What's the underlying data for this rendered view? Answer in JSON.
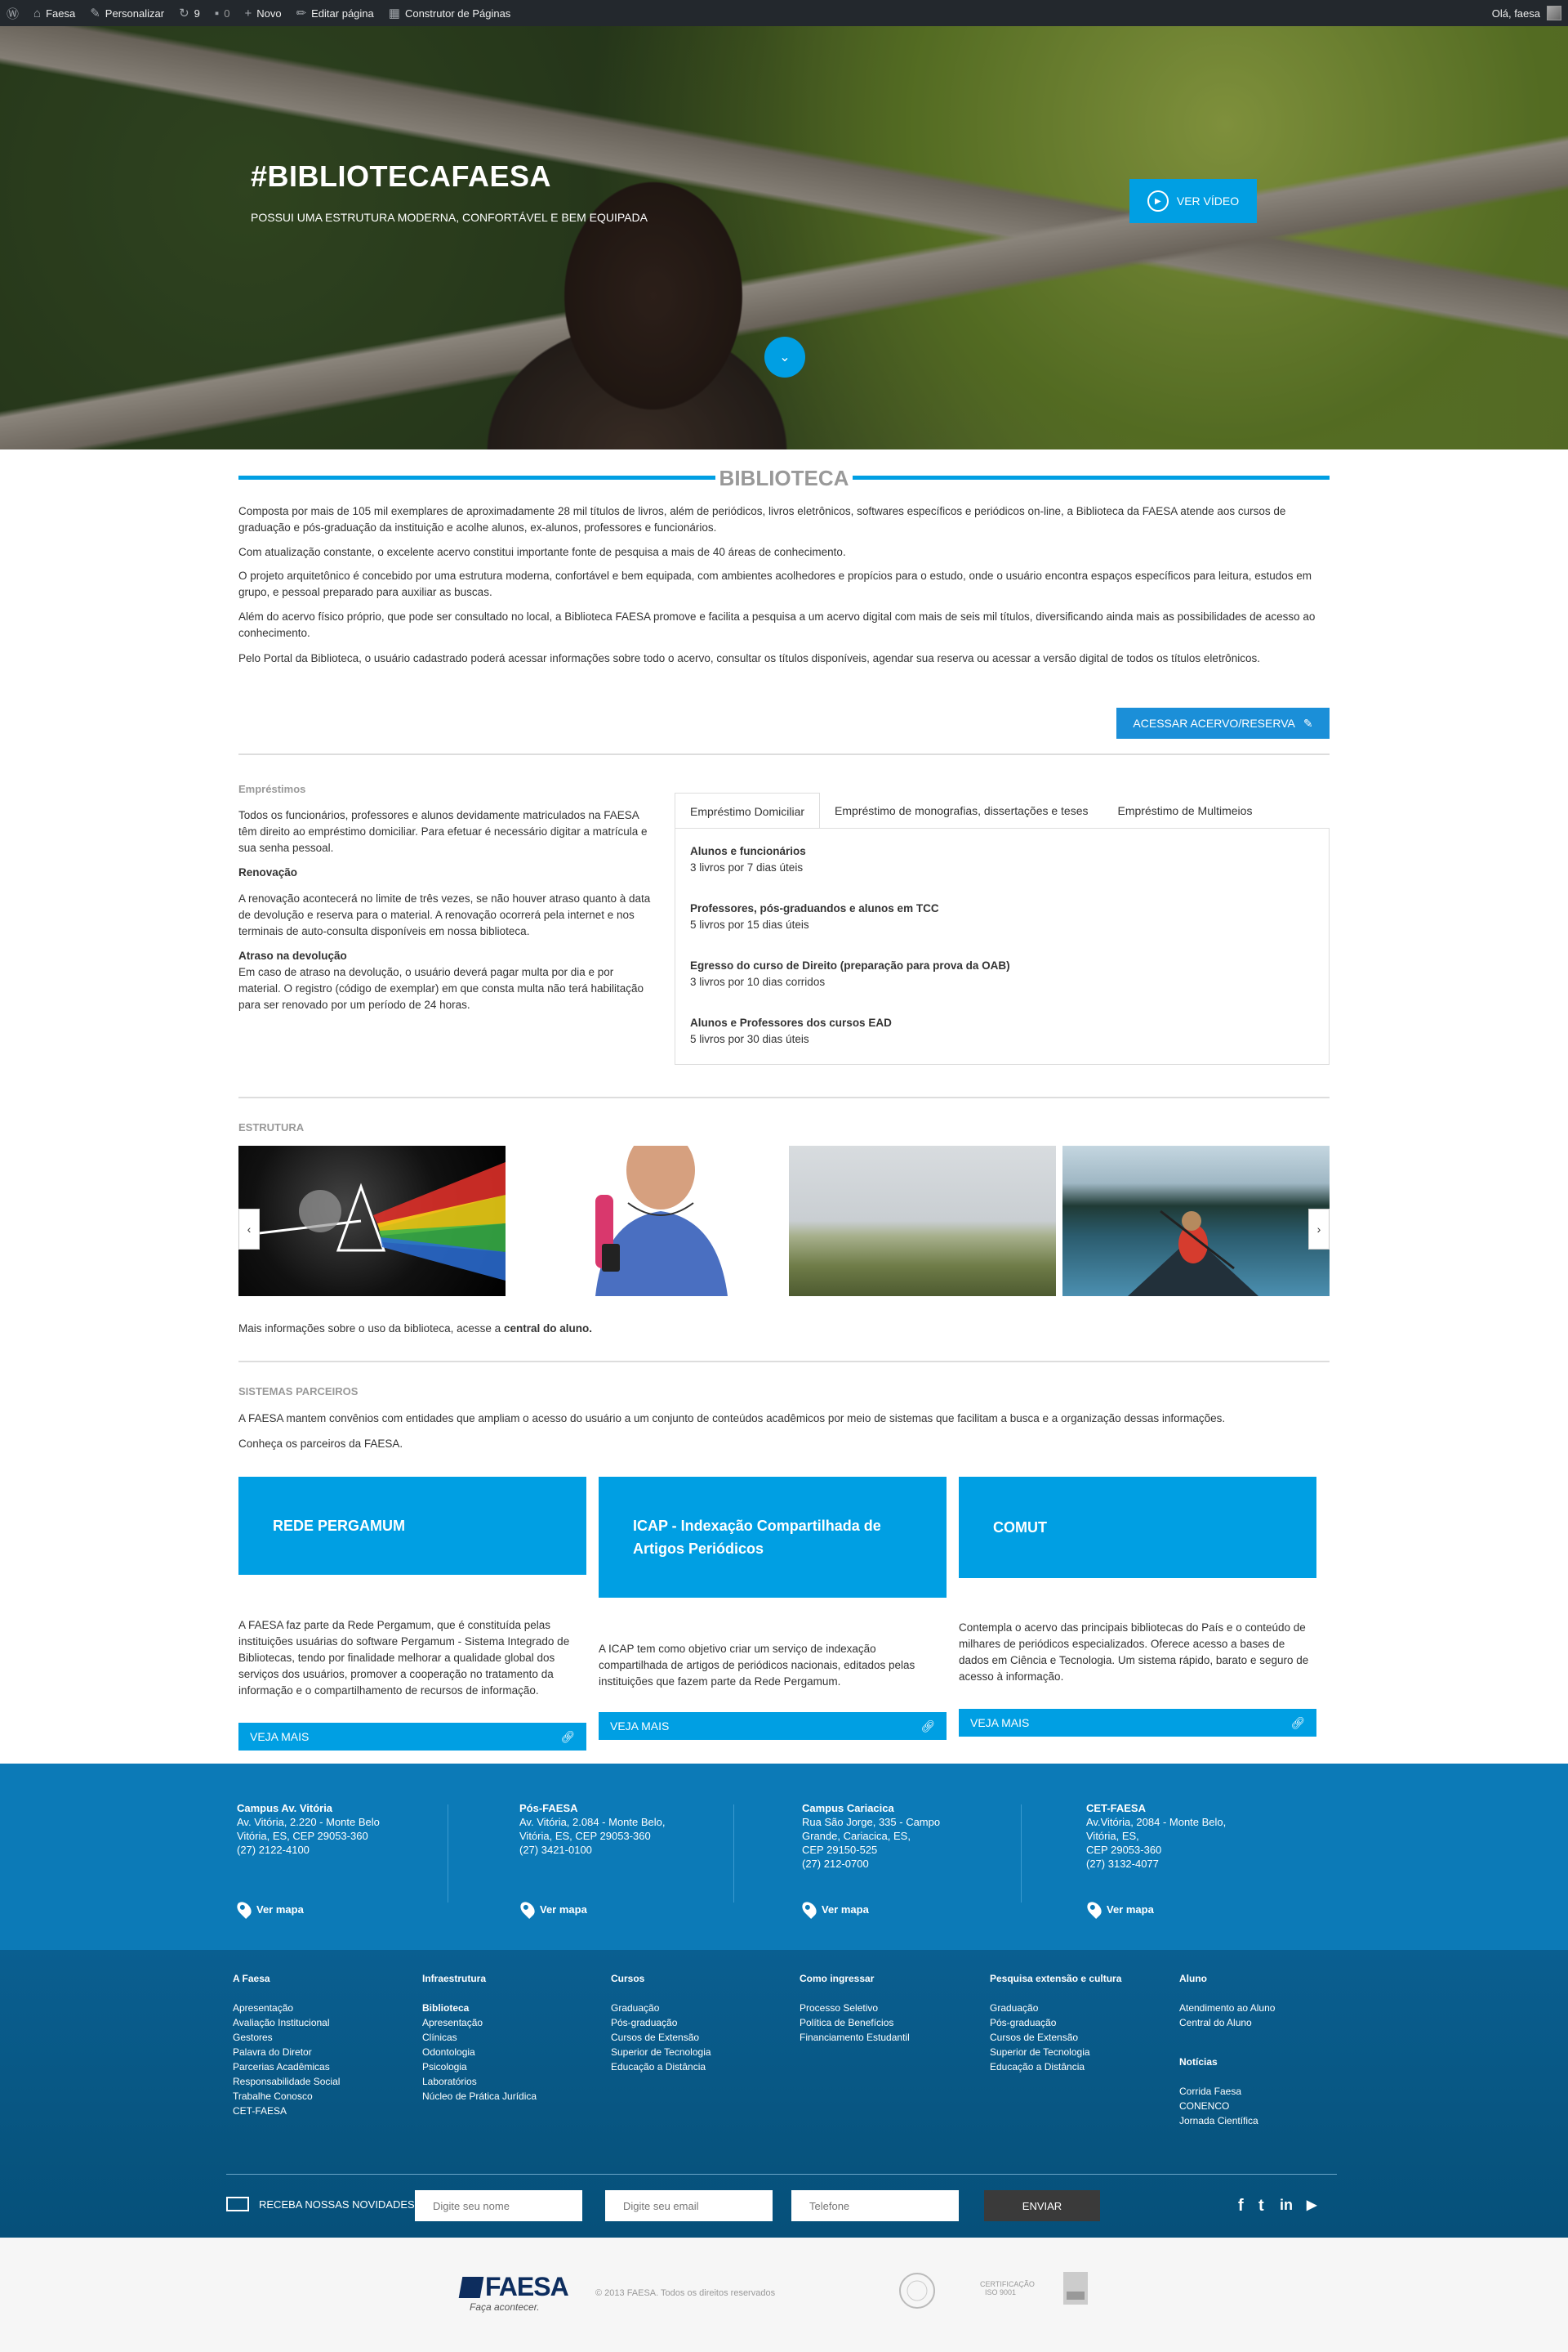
{
  "adminbar": {
    "items": [
      {
        "icon": "wordpress-icon",
        "label": ""
      },
      {
        "icon": "home-icon",
        "label": "Faesa"
      },
      {
        "icon": "brush-icon",
        "label": "Personalizar"
      },
      {
        "icon": "refresh-icon",
        "label": "9"
      },
      {
        "icon": "comment-icon",
        "label": "0"
      },
      {
        "icon": "plus-icon",
        "label": "Novo"
      },
      {
        "icon": "pencil-icon",
        "label": "Editar página"
      },
      {
        "icon": "grid-icon",
        "label": "Construtor de Páginas"
      }
    ],
    "greeting": "Olá, faesa"
  },
  "hero": {
    "title": "#BIBLIOTECAFAESA",
    "subtitle": "POSSUI UMA ESTRUTURA MODERNA, CONFORTÁVEL E BEM EQUIPADA",
    "video_button": "VER VÍDEO"
  },
  "biblioteca": {
    "heading": "BIBLIOTECA",
    "paragraphs": [
      "Composta por mais de 105 mil exemplares de aproximadamente 28 mil títulos de livros, além de periódicos, livros eletrônicos, softwares específicos e periódicos on-line, a Biblioteca da FAESA atende aos cursos de graduação e pós-graduação da instituição e acolhe alunos, ex-alunos, professores e funcionários.",
      "Com atualização constante, o excelente acervo constitui importante fonte de pesquisa a mais de 40 áreas de conhecimento.",
      "O projeto arquitetônico é concebido por uma estrutura moderna, confortável e bem equipada, com ambientes acolhedores e propícios para o estudo, onde o usuário encontra espaços específicos para leitura, estudos em grupo, e pessoal preparado para auxiliar as buscas.",
      "Além do acervo físico próprio, que pode ser consultado no local, a Biblioteca FAESA promove e facilita a pesquisa a um acervo digital com mais de seis mil títulos, diversificando ainda mais as possibilidades de acesso ao conhecimento.",
      "Pelo Portal da Biblioteca, o usuário cadastrado poderá acessar informações sobre todo o acervo, consultar os títulos disponíveis, agendar sua reserva ou acessar a versão digital de todos os títulos eletrônicos."
    ],
    "access_button": "ACESSAR ACERVO/RESERVA"
  },
  "emprestimos": {
    "label": "Empréstimos",
    "intro": "Todos os funcionários, professores e alunos devidamente matriculados na FAESA têm direito ao empréstimo domiciliar. Para efetuar é necessário digitar a matrícula e sua senha pessoal.",
    "renovacao_title": "Renovação",
    "renovacao_text": "A renovação acontecerá no limite de três vezes, se não houver atraso quanto à data de devolução e reserva para o material. A renovação ocorrerá pela internet e nos terminais de auto-consulta disponíveis em nossa biblioteca.",
    "atraso_title": "Atraso na devolução",
    "atraso_text": "Em caso de atraso na devolução, o usuário deverá pagar multa por dia e por material. O registro (código de exemplar) em que consta multa não terá habilitação para ser renovado por um período de 24 horas.",
    "tabs": [
      "Empréstimo Domiciliar",
      "Empréstimo de monografias, dissertações e teses",
      "Empréstimo de Multimeios"
    ],
    "rules": [
      {
        "who": "Alunos e funcionários",
        "what": "3 livros por 7 dias úteis"
      },
      {
        "who": "Professores, pós-graduandos e alunos em TCC",
        "what": "5 livros por 15 dias úteis"
      },
      {
        "who": "Egresso do curso de Direito (preparação para prova da OAB)",
        "what": "3 livros por 10 dias corridos"
      },
      {
        "who": "Alunos e Professores dos cursos EAD",
        "what": "5 livros por 30 dias úteis"
      }
    ]
  },
  "estrutura": {
    "label": "ESTRUTURA",
    "more_prefix": "Mais informações sobre o uso da biblioteca, acesse a ",
    "more_link": "central do aluno."
  },
  "parceiros": {
    "label": "SISTEMAS PARCEIROS",
    "intro": "A FAESA mantem convênios com entidades que ampliam o acesso do usuário a um conjunto de conteúdos acadêmicos por meio de sistemas que facilitam a busca e a organização dessas informações.",
    "intro2": "Conheça os parceiros da FAESA.",
    "cards": [
      {
        "title": "REDE PERGAMUM",
        "text": "A FAESA faz parte da Rede Pergamum, que é constituída pelas instituições usuárias do software Pergamum - Sistema Integrado de Bibliotecas, tendo por finalidade melhorar a qualidade global dos serviços dos usuários, promover a cooperação no tratamento da informação e o compartilhamento de recursos de informação.",
        "button": "VEJA MAIS"
      },
      {
        "title": "ICAP - Indexação Compartilhada de Artigos Periódicos",
        "text": "A ICAP tem como objetivo criar um serviço de indexação compartilhada de artigos de periódicos nacionais, editados pelas instituições que fazem parte da Rede Pergamum.",
        "button": "VEJA MAIS"
      },
      {
        "title": "COMUT",
        "text": "Contempla o acervo das principais bibliotecas do País e o conteúdo de milhares de periódicos especializados. Oferece acesso a bases de dados em Ciência e Tecnologia. Um sistema rápido, barato e seguro de acesso à informação.",
        "button": "VEJA MAIS"
      }
    ]
  },
  "campi": [
    {
      "name": "Campus Av. Vitória",
      "address": "Av. Vitória, 2.220 - Monte Belo\nVitória, ES, CEP 29053-360\n(27) 2122-4100",
      "map": "Ver mapa"
    },
    {
      "name": "Pós-FAESA",
      "address": "Av. Vitória, 2.084 - Monte Belo,\nVitória, ES, CEP 29053-360\n(27) 3421-0100",
      "map": "Ver mapa"
    },
    {
      "name": "Campus Cariacica",
      "address": "Rua São Jorge, 335 - Campo\nGrande, Cariacica, ES,\nCEP 29150-525\n(27) 212-0700",
      "map": "Ver mapa"
    },
    {
      "name": "CET-FAESA",
      "address": "Av.Vitória, 2084 - Monte Belo,\nVitória, ES,\nCEP 29053-360\n(27) 3132-4077",
      "map": "Ver mapa"
    }
  ],
  "footer": {
    "columns": [
      {
        "title": "A Faesa",
        "links": [
          "Apresentação",
          "Avaliação Institucional",
          "Gestores",
          "Palavra do Diretor",
          "Parcerias Acadêmicas",
          "Responsabilidade Social",
          "Trabalhe Conosco",
          "CET-FAESA"
        ]
      },
      {
        "title": "Infraestrutura",
        "links": [
          "Biblioteca",
          "Apresentação",
          "Clínicas",
          "Odontologia",
          "Psicologia",
          "Laboratórios",
          "Núcleo de Prática Jurídica"
        ]
      },
      {
        "title": "Cursos",
        "links": [
          "Graduação",
          "Pós-graduação",
          "Cursos de Extensão",
          "Superior de Tecnologia",
          "Educação a Distância"
        ]
      },
      {
        "title": "Como ingressar",
        "links": [
          "Processo Seletivo",
          "Política de Benefícios",
          "Financiamento Estudantil"
        ]
      },
      {
        "title": "Pesquisa extensão e cultura",
        "links": [
          "Graduação",
          "Pós-graduação",
          "Cursos de Extensão",
          "Superior de Tecnologia",
          "Educação a Distância"
        ]
      },
      {
        "title": "Aluno",
        "links": [
          "Atendimento ao Aluno",
          "Central do Aluno"
        ],
        "title2": "Notícias",
        "links2": [
          "Corrida Faesa",
          "CONENCO",
          "Jornada Científica"
        ]
      }
    ],
    "newsletter_label": "RECEBA NOSSAS NOVIDADES",
    "name_placeholder": "Digite seu nome",
    "email_placeholder": "Digite seu email",
    "phone_placeholder": "Telefone",
    "send_button": "ENVIAR",
    "social": [
      "f",
      "t",
      "in",
      "▶"
    ],
    "logo": "FAESA",
    "tagline": "Faça acontecer.",
    "copyright": "© 2013 FAESA. Todos os direitos reservados",
    "seals": [
      "",
      "CERTIFICAÇÃO ISO 9001",
      ""
    ]
  }
}
